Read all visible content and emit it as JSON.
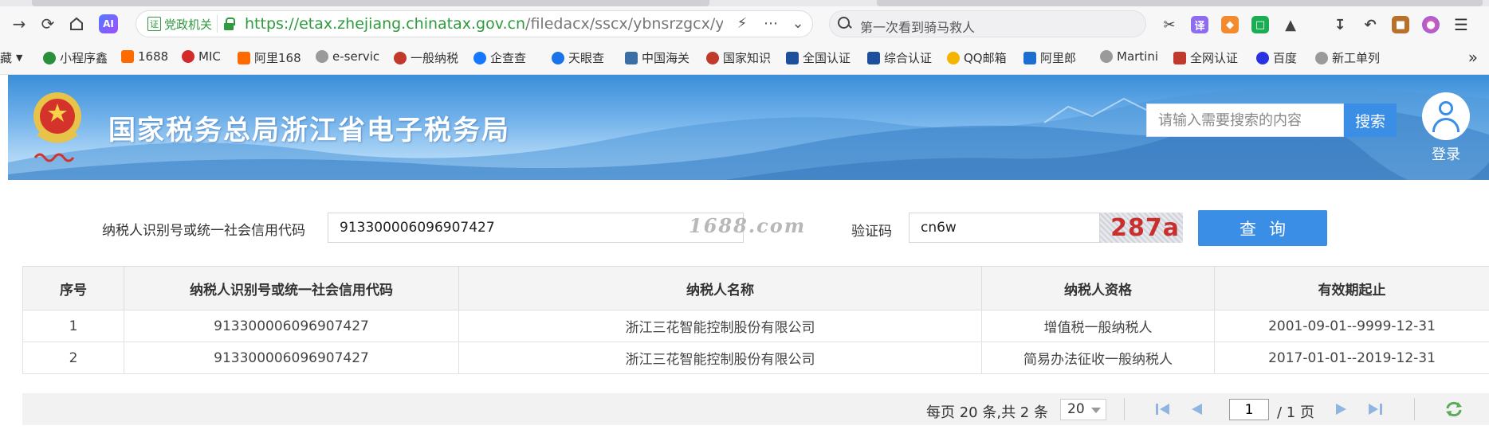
{
  "browser": {
    "address": {
      "gov_badge_icon": "证",
      "gov_badge": "党政机关",
      "url_scheme": "https://",
      "url_host": "etax.zhejiang.chinatax.gov.cn",
      "url_path": "/filedacx/sscx/ybnsrzgcx/ybnsrzgcx"
    },
    "search": {
      "text": "第一次看到骑马救人"
    },
    "extensions": [
      "cut-icon",
      "translate-icon",
      "game-icon",
      "green-square-icon",
      "puzzle-icon",
      "download-icon",
      "undo-icon",
      "briefcase-icon",
      "ai-icon",
      "menu-icon"
    ],
    "ext_labels": {
      "translate": "译"
    },
    "ai_label": "AI",
    "bookmarks": [
      {
        "label": "藏",
        "color": "#999999"
      },
      {
        "label": "小程序鑫",
        "color": "#2a8f3a"
      },
      {
        "label": "1688",
        "color": "#ff6a00"
      },
      {
        "label": "MIC",
        "color": "#d22b2b"
      },
      {
        "label": "阿里168",
        "color": "#ff6a00"
      },
      {
        "label": "e-servic",
        "color": "#888888"
      },
      {
        "label": "一般纳税",
        "color": "#c0392b"
      },
      {
        "label": "企查查",
        "color": "#1677ff"
      },
      {
        "label": "天眼查",
        "color": "#1a73e8"
      },
      {
        "label": "中国海关",
        "color": "#3a6ea5"
      },
      {
        "label": "国家知识",
        "color": "#c0392b"
      },
      {
        "label": "全国认证",
        "color": "#1c4f9c"
      },
      {
        "label": "综合认证",
        "color": "#1c4f9c"
      },
      {
        "label": "QQ邮箱",
        "color": "#f4b400"
      },
      {
        "label": "阿里郎",
        "color": "#1c6fd1"
      },
      {
        "label": "Martini",
        "color": "#888888"
      },
      {
        "label": "全网认证",
        "color": "#c0392b"
      },
      {
        "label": "百度",
        "color": "#2932e1"
      },
      {
        "label": "新工单列",
        "color": "#888888"
      }
    ],
    "bookmarks_more": "»"
  },
  "site": {
    "title": "国家税务总局浙江省电子税务局",
    "search_placeholder": "请输入需要搜索的内容",
    "search_btn": "搜索",
    "login": "登录"
  },
  "form": {
    "id_label": "纳税人识别号或统一社会信用代码",
    "id_value": "913300006096907427",
    "watermark": "1688.com",
    "captcha_label": "验证码",
    "captcha_value": "cn6w",
    "captcha_image_text": "287a",
    "query_btn": "查询"
  },
  "table": {
    "headers": [
      "序号",
      "纳税人识别号或统一社会信用代码",
      "纳税人名称",
      "纳税人资格",
      "有效期起止"
    ],
    "rows": [
      [
        "1",
        "913300006096907427",
        "浙江三花智能控制股份有限公司",
        "增值税一般纳税人",
        "2001-09-01--9999-12-31"
      ],
      [
        "2",
        "913300006096907427",
        "浙江三花智能控制股份有限公司",
        "简易办法征收一般纳税人",
        "2017-01-01--2019-12-31"
      ]
    ]
  },
  "pager": {
    "info": "每页 20 条,共 2 条",
    "page_size": "20",
    "current_page": "1",
    "total_pages": "/ 1 页"
  },
  "colors": {
    "accent": "#3a8ee6",
    "secure": "#2f9a3e"
  }
}
